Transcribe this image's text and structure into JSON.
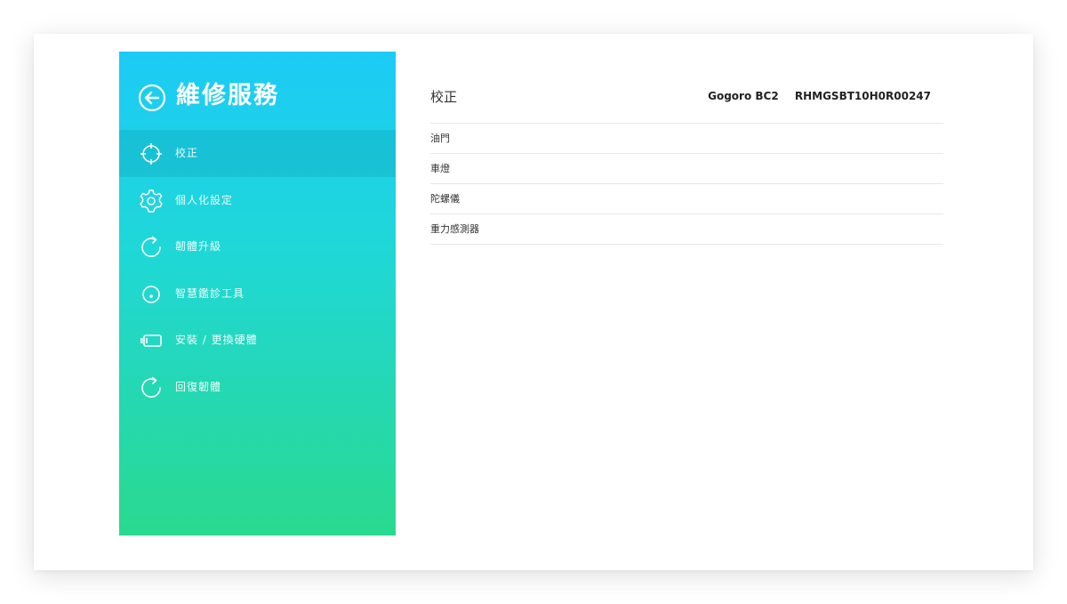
{
  "sidebar": {
    "title": "維修服務",
    "back_icon": "back-arrow-icon",
    "items": [
      {
        "label": "校正",
        "icon": "crosshair-icon",
        "active": true
      },
      {
        "label": "個人化設定",
        "icon": "gear-icon",
        "active": false
      },
      {
        "label": "韌體升級",
        "icon": "refresh-icon",
        "active": false
      },
      {
        "label": "智慧鑑診工具",
        "icon": "diagnostic-icon",
        "active": false
      },
      {
        "label": "安裝 / 更換硬體",
        "icon": "battery-icon",
        "active": false
      },
      {
        "label": "回復韌體",
        "icon": "refresh-icon",
        "active": false
      }
    ],
    "gradient": [
      "#1ccbf6",
      "#1fd8d6",
      "#2ad98f"
    ]
  },
  "content": {
    "title": "校正",
    "device_model": "Gogoro BC2",
    "device_serial": "RHMGSBT10H0R00247",
    "items": [
      {
        "label": "油門"
      },
      {
        "label": "車燈"
      },
      {
        "label": "陀螺儀"
      },
      {
        "label": "重力感測器"
      }
    ]
  }
}
